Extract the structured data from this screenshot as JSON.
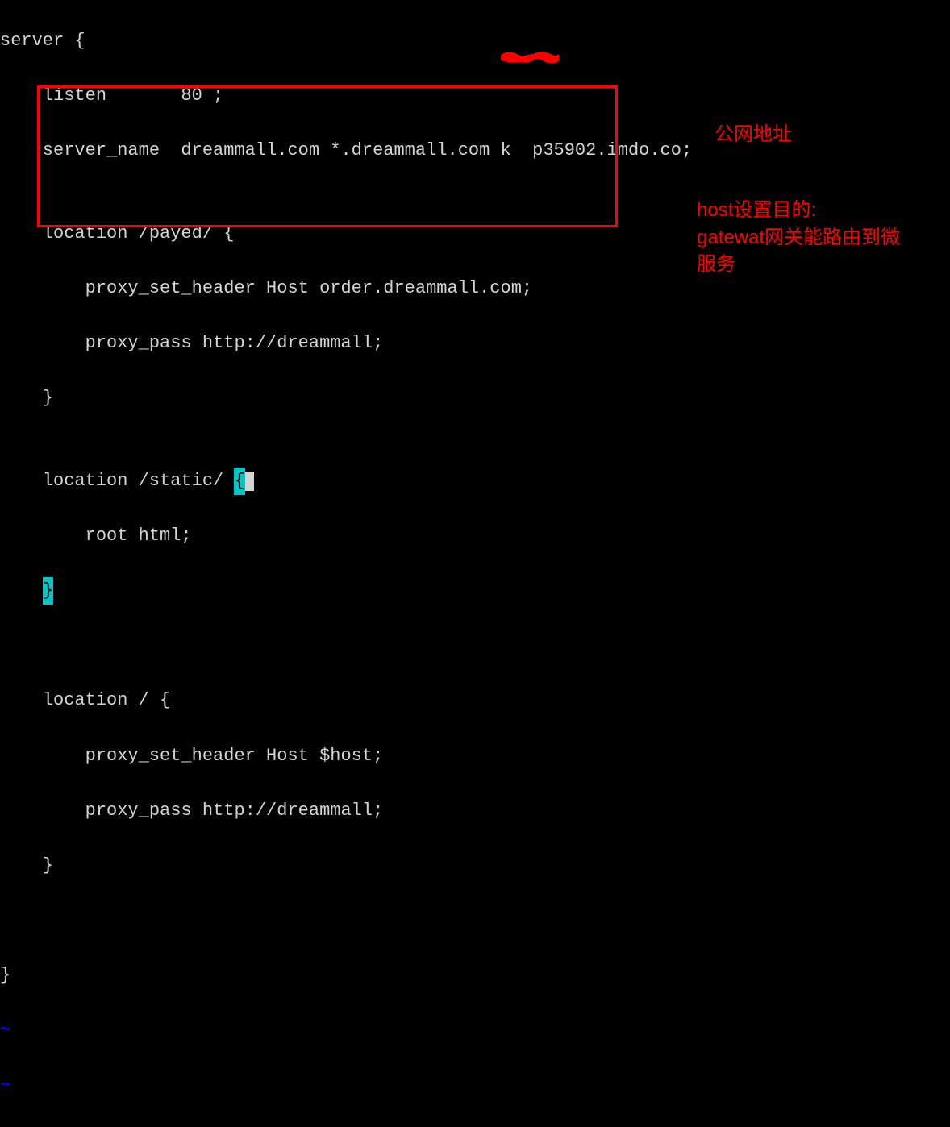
{
  "code": {
    "line01": "server {",
    "line02": "    listen       80 ;",
    "line03_a": "    server_name  dreammall.com *.dreammall.com ",
    "line03_b": "35902.imdo.co;",
    "line04": "",
    "line05": "    location /payed/ {",
    "line06": "        proxy_set_header Host order.dreammall.com;",
    "line07": "        proxy_pass http://dreammall;",
    "line08": "    }",
    "line09": "",
    "line10_a": "    location /static/ ",
    "line10_brace": "{",
    "line11": "        root html;",
    "line12_indent": "    ",
    "line12_brace": "}",
    "line13": "",
    "line14": "",
    "line15": "    location / {",
    "line16": "        proxy_set_header Host $host;",
    "line17": "        proxy_pass http://dreammall;",
    "line18": "    }",
    "line19": "",
    "line20": "",
    "line21": "}",
    "tilde": "~"
  },
  "redacted_text": "k  p",
  "annotations": {
    "label1": "公网地址",
    "label2": "host设置目的:\ngatewat网关能路由到微服务"
  }
}
